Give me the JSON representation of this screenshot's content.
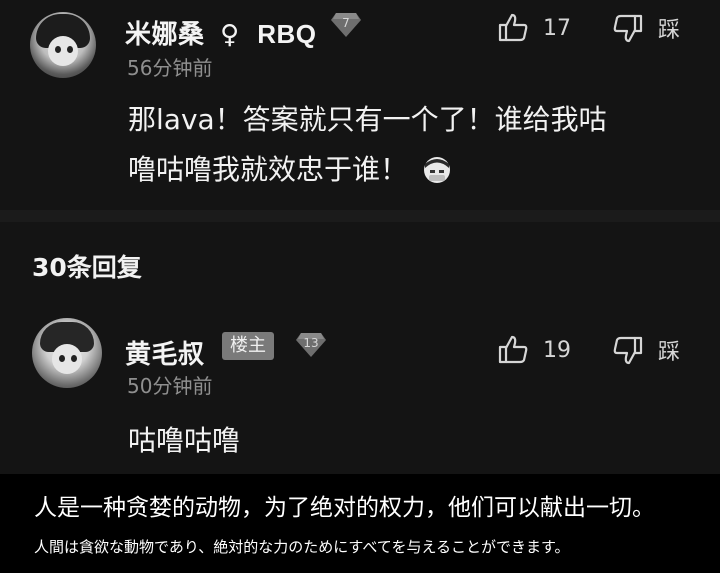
{
  "comment1": {
    "username": "米娜桑",
    "gender_symbol": "♀",
    "tag": "RBQ",
    "level": "7",
    "time": "56分钟前",
    "text_line1": "那lava！答案就只有一个了！谁给我咕",
    "text_line2": "噜咕噜我就效忠于谁！",
    "like_count": "17",
    "dislike_label": "踩"
  },
  "replies": {
    "count_label": "30条回复"
  },
  "reply1": {
    "username": "黄毛叔",
    "op_label": "楼主",
    "level": "13",
    "time": "50分钟前",
    "text": "咕噜咕噜",
    "like_count": "19",
    "dislike_label": "踩"
  },
  "subtitles": {
    "zh": "人是一种贪婪的动物，为了绝对的权力，他们可以献出一切。",
    "ja": "人間は貪欲な動物であり、絶対的な力のためにすべてを与えることができます。"
  },
  "colors": {
    "background": "#141414",
    "time_gray": "#8f8f8f",
    "badge_gray": "#7a7a7a",
    "subtitle_bg": "#000000"
  },
  "icons": [
    "thumbs-up-icon",
    "thumbs-down-icon",
    "diamond-level-icon",
    "emoji-face-icon",
    "avatar"
  ]
}
